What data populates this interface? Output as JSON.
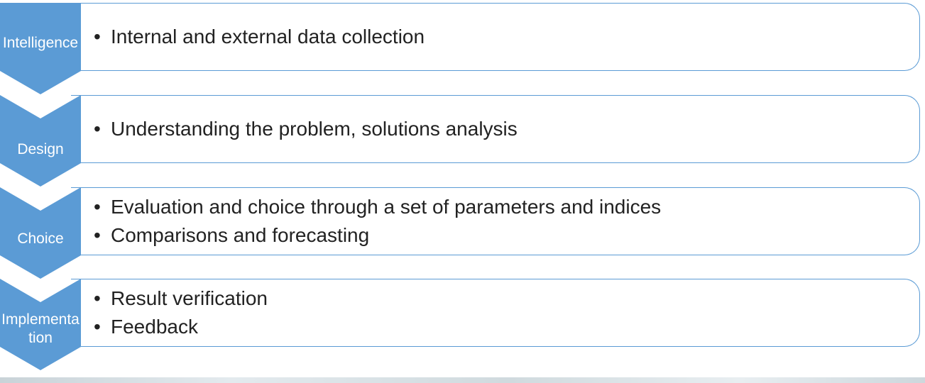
{
  "colors": {
    "chevron_fill": "#5b9bd5",
    "box_border": "#5b9bd5",
    "chevron_text": "#ffffff",
    "body_text": "#222222"
  },
  "stages": [
    {
      "label": "Intelligence",
      "bullets": [
        "Internal and external data collection"
      ]
    },
    {
      "label": "Design",
      "bullets": [
        "Understanding the problem, solutions analysis"
      ]
    },
    {
      "label": "Choice",
      "bullets": [
        "Evaluation and choice through a set of parameters and indices",
        "Comparisons and forecasting"
      ]
    },
    {
      "label": "Implementation",
      "bullets": [
        "Result verification",
        "Feedback"
      ]
    }
  ]
}
